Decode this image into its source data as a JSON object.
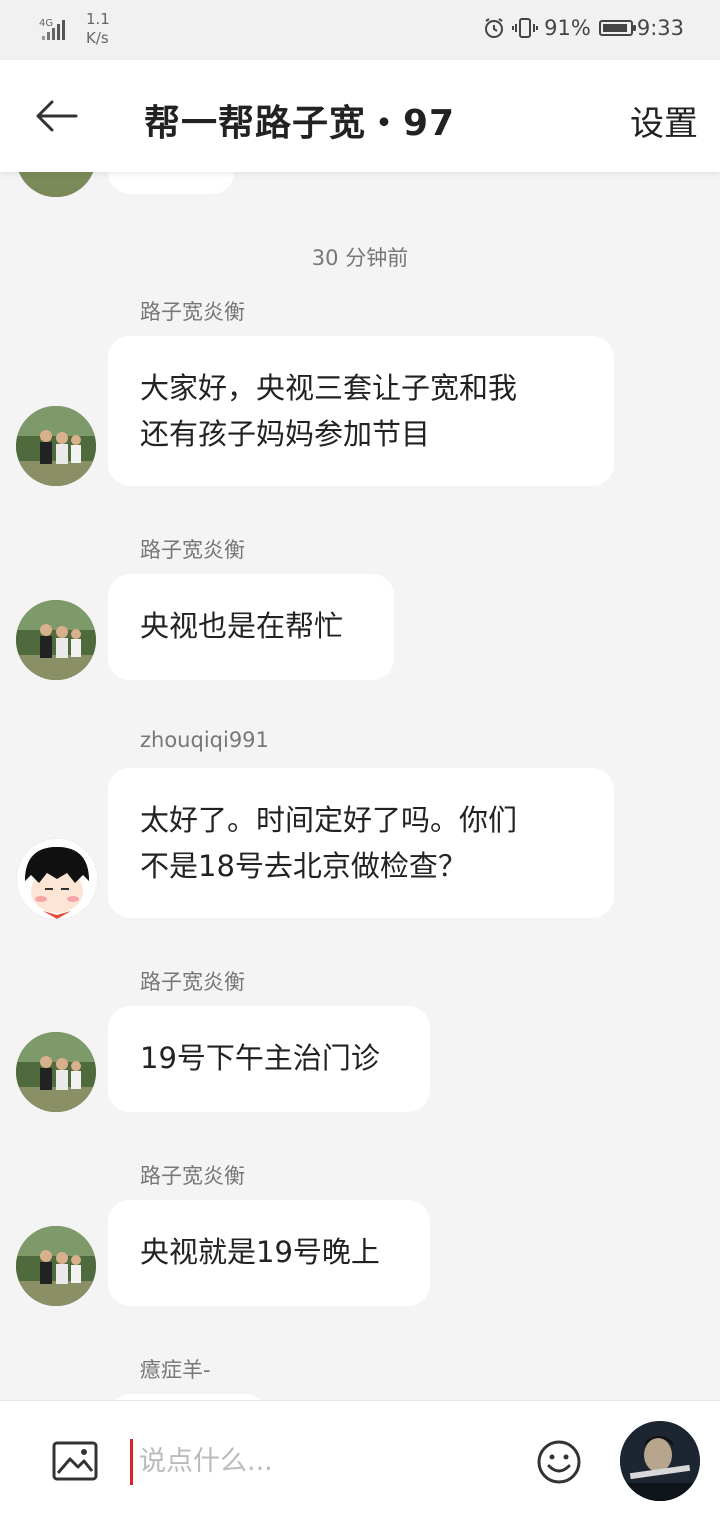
{
  "status_bar": {
    "network": "4G",
    "speed_value": "1.1",
    "speed_unit": "K/s",
    "battery": "91%",
    "battery_level": 0.91,
    "time": "9:33"
  },
  "header": {
    "title": "帮一帮路子宽・97",
    "settings_label": "设置"
  },
  "chat": {
    "timestamp": "30 分钟前",
    "messages": [
      {
        "sender": "路子宽炎衡",
        "lines": [
          "大家好，央视三套让子宽和我",
          "还有孩子妈妈参加节目"
        ]
      },
      {
        "sender": "路子宽炎衡",
        "lines": [
          "央视也是在帮忙"
        ]
      },
      {
        "sender": "zhouqiqi991",
        "lines": [
          "太好了。时间定好了吗。你们",
          "不是18号去北京做检查？"
        ]
      },
      {
        "sender": "路子宽炎衡",
        "lines": [
          "19号下午主治门诊"
        ]
      },
      {
        "sender": "路子宽炎衡",
        "lines": [
          "央视就是19号晚上"
        ]
      },
      {
        "sender": "癔症羊-"
      }
    ]
  },
  "input": {
    "placeholder": "说点什么..."
  },
  "icons": {
    "back": "arrow-left-icon",
    "image": "image-icon",
    "emoji": "smiley-icon",
    "alarm": "alarm-clock-icon",
    "vibrate": "vibrate-icon"
  }
}
